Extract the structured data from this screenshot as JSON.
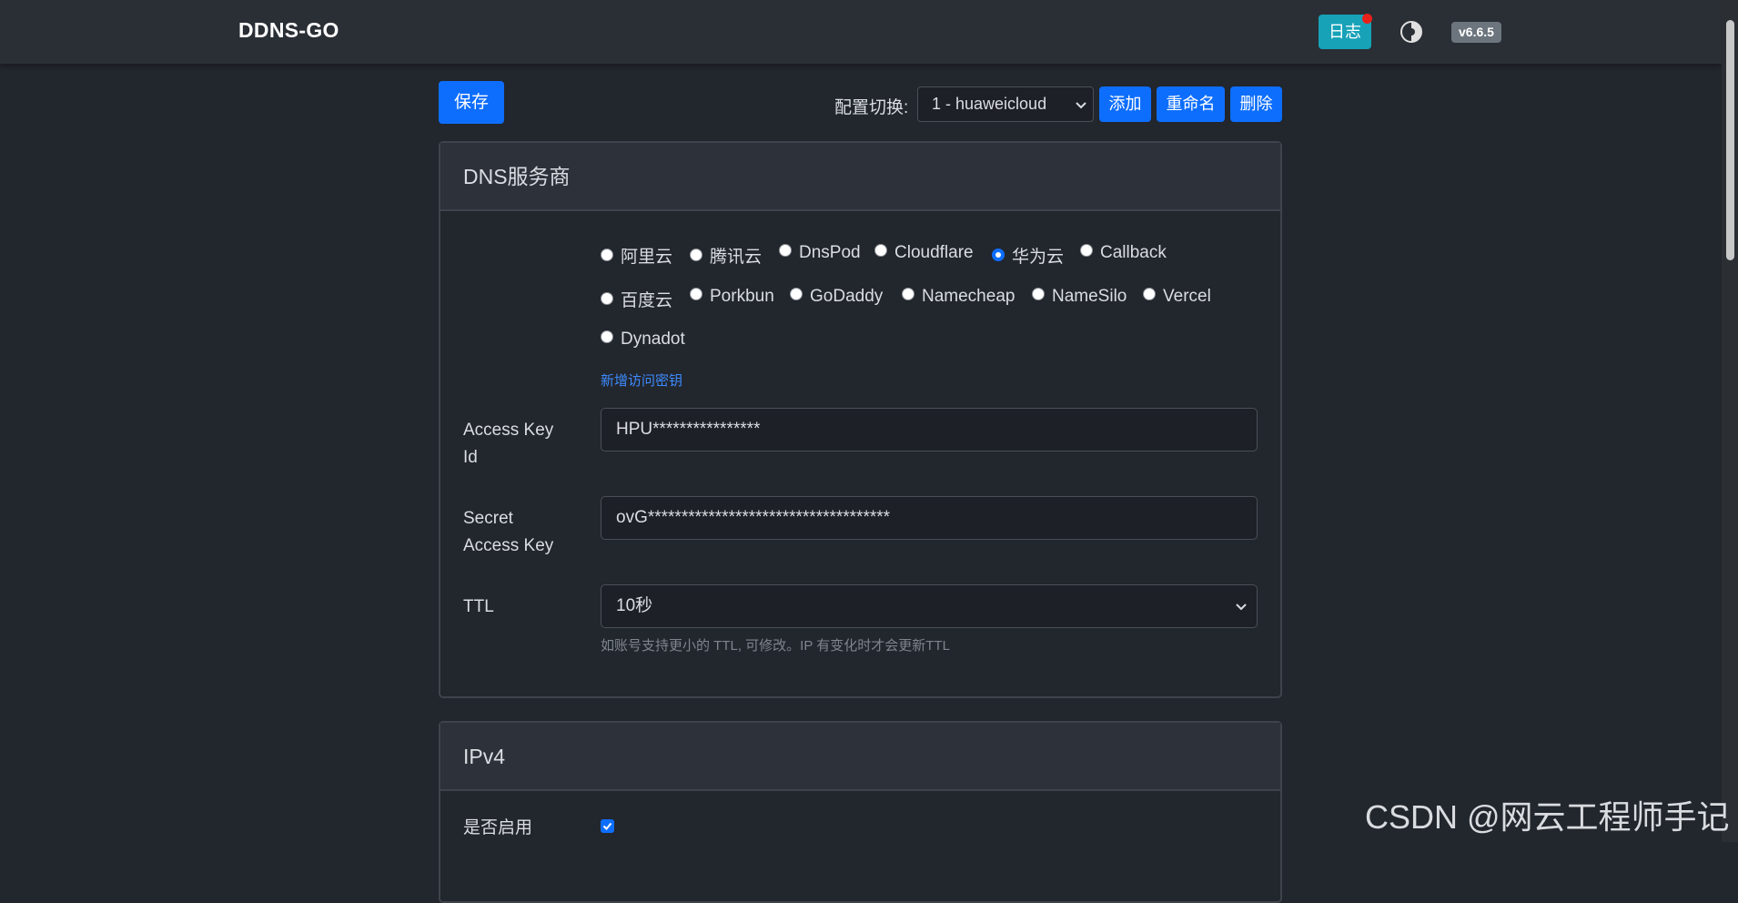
{
  "navbar": {
    "brand": "DDNS-GO",
    "log_label": "日志",
    "version": "v6.6.5"
  },
  "toolbar": {
    "save_label": "保存",
    "switch_label": "配置切换:",
    "config_selected": "1 - huaweicloud",
    "add_label": "添加",
    "rename_label": "重命名",
    "delete_label": "删除"
  },
  "dns_card": {
    "title": "DNS服务商",
    "providers": [
      {
        "label": "阿里云",
        "checked": false
      },
      {
        "label": "腾讯云",
        "checked": false
      },
      {
        "label": "DnsPod",
        "checked": false
      },
      {
        "label": "Cloudflare",
        "checked": false
      },
      {
        "label": "华为云",
        "checked": true
      },
      {
        "label": "Callback",
        "checked": false
      },
      {
        "label": "百度云",
        "checked": false
      },
      {
        "label": "Porkbun",
        "checked": false
      },
      {
        "label": "GoDaddy",
        "checked": false
      },
      {
        "label": "Namecheap",
        "checked": false
      },
      {
        "label": "NameSilo",
        "checked": false
      },
      {
        "label": "Vercel",
        "checked": false
      },
      {
        "label": "Dynadot",
        "checked": false
      }
    ],
    "add_key_link": "新增访问密钥",
    "access_key_id_label_1": "Access Key",
    "access_key_id_label_2": "Id",
    "access_key_id_value": "HPU****************",
    "secret_label_1": "Secret",
    "secret_label_2": "Access Key",
    "secret_value": "ovG************************************",
    "ttl_label": "TTL",
    "ttl_value": "10秒",
    "ttl_help": "如账号支持更小的 TTL, 可修改。IP 有变化时才会更新TTL"
  },
  "ipv4_card": {
    "title": "IPv4",
    "enable_label": "是否启用",
    "enabled": true
  },
  "watermark": "CSDN @网云工程师手记",
  "colors": {
    "primary": "#0d6efd",
    "info": "#17a2b8",
    "background": "#22262d"
  }
}
